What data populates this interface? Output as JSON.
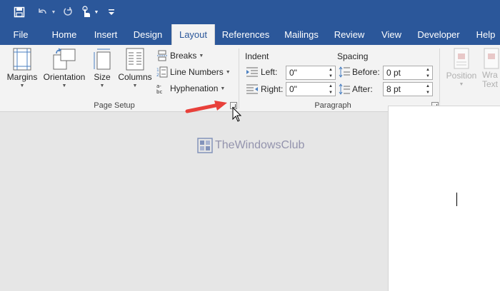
{
  "qat": {
    "icons": [
      "save-icon",
      "undo-icon",
      "redo-icon",
      "touch-mode-icon",
      "customize-qat-icon"
    ]
  },
  "tabs": [
    {
      "label": "File",
      "active": false
    },
    {
      "label": "Home",
      "active": false
    },
    {
      "label": "Insert",
      "active": false
    },
    {
      "label": "Design",
      "active": false
    },
    {
      "label": "Layout",
      "active": true
    },
    {
      "label": "References",
      "active": false
    },
    {
      "label": "Mailings",
      "active": false
    },
    {
      "label": "Review",
      "active": false
    },
    {
      "label": "View",
      "active": false
    },
    {
      "label": "Developer",
      "active": false
    },
    {
      "label": "Help",
      "active": false
    }
  ],
  "page_setup": {
    "group_label": "Page Setup",
    "margins": "Margins",
    "orientation": "Orientation",
    "size": "Size",
    "columns": "Columns",
    "breaks": "Breaks",
    "line_numbers": "Line Numbers",
    "hyphenation": "Hyphenation"
  },
  "paragraph": {
    "group_label": "Paragraph",
    "indent_label": "Indent",
    "spacing_label": "Spacing",
    "left_label": "Left:",
    "left_value": "0\"",
    "right_label": "Right:",
    "right_value": "0\"",
    "before_label": "Before:",
    "before_value": "0 pt",
    "after_label": "After:",
    "after_value": "8 pt"
  },
  "arrange": {
    "position": "Position",
    "wrap_text_line1": "Wra",
    "wrap_text_line2": "Text"
  },
  "watermark": "TheWindowsClub",
  "colors": {
    "accent": "#2b579a",
    "ribbon_bg": "#f3f3f3",
    "doc_bg": "#e6e6e6",
    "annotation_arrow": "#e8403a"
  }
}
